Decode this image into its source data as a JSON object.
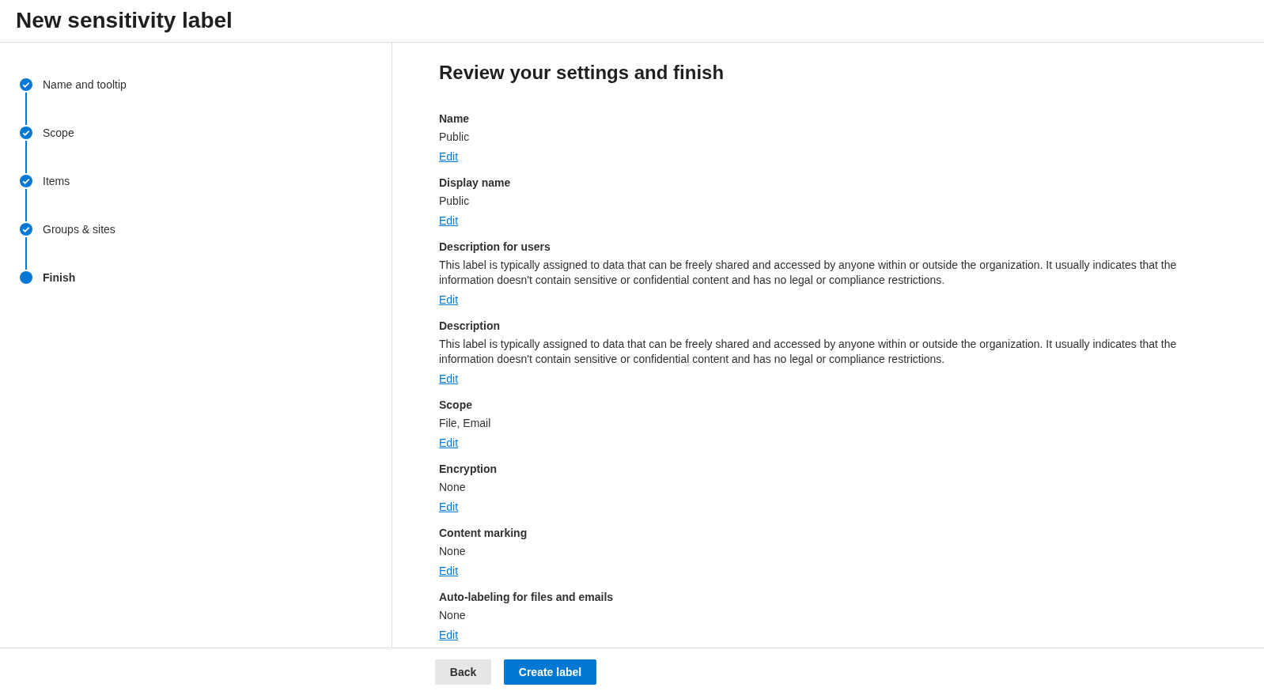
{
  "header": {
    "title": "New sensitivity label"
  },
  "steps": [
    {
      "label": "Name and tooltip",
      "completed": true,
      "selected": false
    },
    {
      "label": "Scope",
      "completed": true,
      "selected": false
    },
    {
      "label": "Items",
      "completed": true,
      "selected": false
    },
    {
      "label": "Groups & sites",
      "completed": true,
      "selected": false
    },
    {
      "label": "Finish",
      "completed": false,
      "selected": true
    }
  ],
  "review": {
    "title": "Review your settings and finish",
    "sections": [
      {
        "heading": "Name",
        "value": "Public",
        "edit": "Edit"
      },
      {
        "heading": "Display name",
        "value": "Public",
        "edit": "Edit"
      },
      {
        "heading": "Description for users",
        "value": "This label is typically assigned to data that can be freely shared and accessed by anyone within or outside the organization. It usually indicates that the information doesn't contain sensitive or confidential content and has no legal or compliance restrictions.",
        "edit": "Edit"
      },
      {
        "heading": "Description",
        "value": "This label is typically assigned to data that can be freely shared and accessed by anyone within or outside the organization. It usually indicates that the information doesn't contain sensitive or confidential content and has no legal or compliance restrictions.",
        "edit": "Edit"
      },
      {
        "heading": "Scope",
        "value": "File, Email",
        "edit": "Edit"
      },
      {
        "heading": "Encryption",
        "value": "None",
        "edit": "Edit"
      },
      {
        "heading": "Content marking",
        "value": "None",
        "edit": "Edit"
      },
      {
        "heading": "Auto-labeling for files and emails",
        "value": "None",
        "edit": "Edit"
      }
    ]
  },
  "footer": {
    "buttons": [
      {
        "label": "Back",
        "kind": "secondary"
      },
      {
        "label": "Create label",
        "kind": "primary"
      }
    ]
  }
}
